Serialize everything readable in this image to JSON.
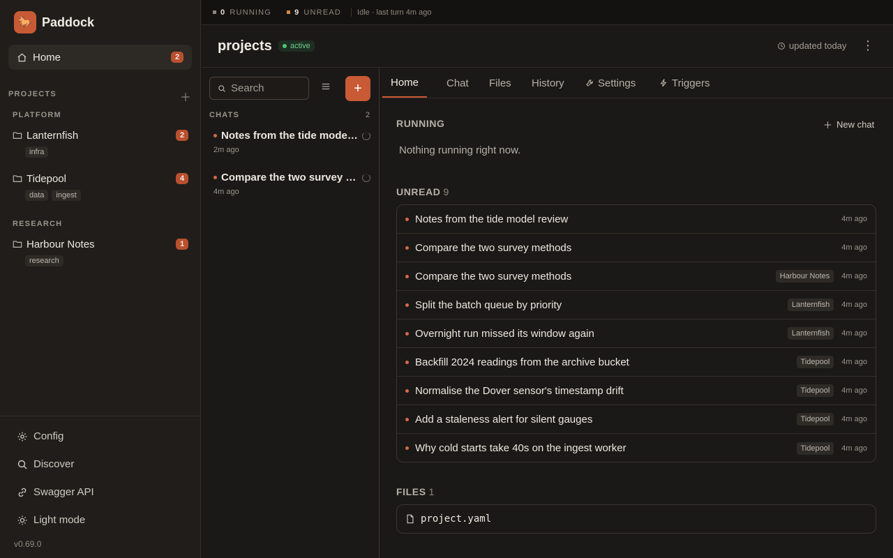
{
  "brand": {
    "name": "Paddock",
    "logo": "horse-icon"
  },
  "sidebar": {
    "home": {
      "label": "Home",
      "badge": "2"
    },
    "projects_label": "PROJECTS",
    "groups": [
      {
        "label": "PLATFORM",
        "projects": [
          {
            "name": "Lanternfish",
            "badge": "2",
            "tags": [
              "infra"
            ]
          },
          {
            "name": "Tidepool",
            "badge": "4",
            "tags": [
              "data",
              "ingest"
            ]
          }
        ]
      },
      {
        "label": "RESEARCH",
        "projects": [
          {
            "name": "Harbour Notes",
            "badge": "1",
            "tags": [
              "research"
            ]
          }
        ]
      }
    ],
    "bottom": [
      {
        "label": "Config",
        "icon": "gear-icon"
      },
      {
        "label": "Discover",
        "icon": "search-icon"
      },
      {
        "label": "Swagger API",
        "icon": "link-icon"
      },
      {
        "label": "Light mode",
        "icon": "sun-icon"
      }
    ],
    "version": "v0.69.0"
  },
  "topbar": {
    "running_count": "0",
    "running_label": "RUNNING",
    "running_color": "#8e887f",
    "unread_count": "9",
    "unread_label": "UNREAD",
    "unread_color": "#d58a3a",
    "idle": "Idle · last turn 4m ago"
  },
  "project": {
    "title": "projects",
    "status": "active",
    "updated": "updated today"
  },
  "chats": {
    "search_placeholder": "Search",
    "label": "CHATS",
    "count": "2",
    "items": [
      {
        "title": "Notes from the tide model review",
        "time": "2m ago"
      },
      {
        "title": "Compare the two survey methods",
        "time": "4m ago"
      }
    ]
  },
  "tabs": [
    {
      "label": "Home",
      "active": true
    },
    {
      "label": "Chat"
    },
    {
      "label": "Files"
    },
    {
      "label": "History"
    },
    {
      "label": "Settings",
      "icon": "wrench-icon"
    },
    {
      "label": "Triggers",
      "icon": "bolt-icon"
    }
  ],
  "main": {
    "running_label": "RUNNING",
    "new_chat": "New chat",
    "empty": "Nothing running right now.",
    "unread_label": "UNREAD",
    "unread_count": "9",
    "unread": [
      {
        "title": "Notes from the tide model review",
        "project": "",
        "time": "4m ago"
      },
      {
        "title": "Compare the two survey methods",
        "project": "",
        "time": "4m ago"
      },
      {
        "title": "Compare the two survey methods",
        "project": "Harbour Notes",
        "time": "4m ago"
      },
      {
        "title": "Split the batch queue by priority",
        "project": "Lanternfish",
        "time": "4m ago"
      },
      {
        "title": "Overnight run missed its window again",
        "project": "Lanternfish",
        "time": "4m ago"
      },
      {
        "title": "Backfill 2024 readings from the archive bucket",
        "project": "Tidepool",
        "time": "4m ago"
      },
      {
        "title": "Normalise the Dover sensor's timestamp drift",
        "project": "Tidepool",
        "time": "4m ago"
      },
      {
        "title": "Add a staleness alert for silent gauges",
        "project": "Tidepool",
        "time": "4m ago"
      },
      {
        "title": "Why cold starts take 40s on the ingest worker",
        "project": "Tidepool",
        "time": "4m ago"
      }
    ],
    "files_label": "FILES",
    "files_count": "1",
    "files": [
      {
        "name": "project.yaml"
      }
    ]
  }
}
